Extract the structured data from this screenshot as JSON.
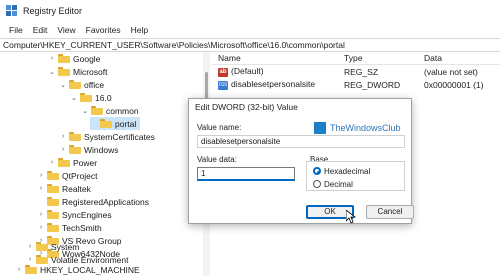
{
  "window": {
    "title": "Registry Editor"
  },
  "menu": [
    "File",
    "Edit",
    "View",
    "Favorites",
    "Help"
  ],
  "address": "Computer\\HKEY_CURRENT_USER\\Software\\Policies\\Microsoft\\office\\16.0\\common\\portal",
  "tree": [
    {
      "label": "Google",
      "expander": "›"
    },
    {
      "label": "Microsoft",
      "expander": "⌄"
    },
    {
      "label": "office",
      "expander": "⌄"
    },
    {
      "label": "16.0",
      "expander": "⌄"
    },
    {
      "label": "common",
      "expander": "⌄"
    },
    {
      "label": "portal",
      "expander": ""
    },
    {
      "label": "SystemCertificates",
      "expander": "›"
    },
    {
      "label": "Windows",
      "expander": "›"
    },
    {
      "label": "Power",
      "expander": "›"
    },
    {
      "label": "QtProject",
      "expander": "›"
    },
    {
      "label": "Realtek",
      "expander": "›"
    },
    {
      "label": "RegisteredApplications",
      "expander": ""
    },
    {
      "label": "SyncEngines",
      "expander": "›"
    },
    {
      "label": "TechSmith",
      "expander": "›"
    },
    {
      "label": "VS Revo Group",
      "expander": "›"
    },
    {
      "label": "Wow6432Node",
      "expander": "›"
    },
    {
      "label": "System",
      "expander": "›"
    },
    {
      "label": "Volatile Environment",
      "expander": "›"
    },
    {
      "label": "HKEY_LOCAL_MACHINE",
      "expander": "›"
    }
  ],
  "values": {
    "headers": {
      "name": "Name",
      "type": "Type",
      "data": "Data"
    },
    "rows": [
      {
        "icon": "ab",
        "name": "(Default)",
        "type": "REG_SZ",
        "data": "(value not set)"
      },
      {
        "icon": "bin",
        "name": "disablesetpersonalsite",
        "type": "REG_DWORD",
        "data": "0x00000001 (1)"
      }
    ]
  },
  "dialog": {
    "title": "Edit DWORD (32-bit) Value",
    "value_name_label": "Value name:",
    "value_name": "disablesetpersonalsite",
    "value_data_label": "Value data:",
    "value_data": "1",
    "base_label": "Base",
    "hex_label": "Hexadecimal",
    "dec_label": "Decimal",
    "base_selected": "Hexadecimal",
    "ok_label": "OK",
    "cancel_label": "Cancel"
  },
  "watermark": "TheWindowsClub",
  "colors": {
    "accent": "#0067c0",
    "selection": "#cce4f7",
    "folder": "#f2c94c"
  }
}
